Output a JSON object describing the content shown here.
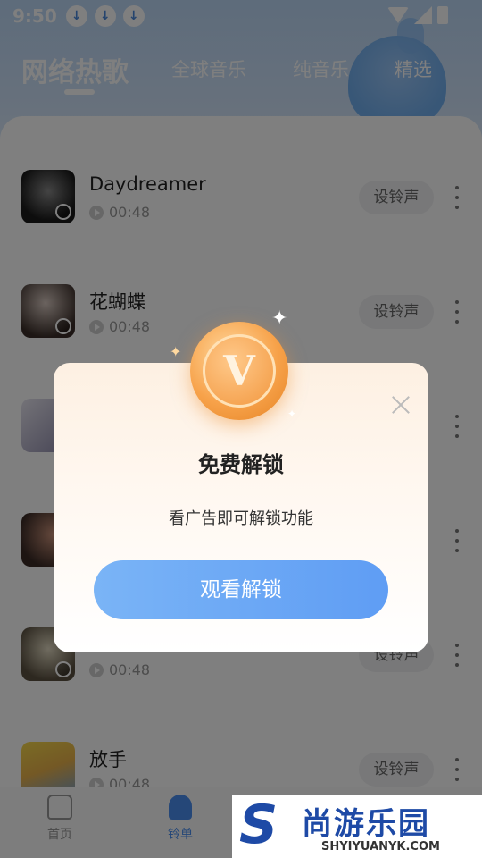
{
  "status_bar": {
    "time": "9:50",
    "download_icons": [
      "download-icon",
      "download-icon",
      "download-icon"
    ]
  },
  "tabs": [
    {
      "label": "网络热歌",
      "active": true
    },
    {
      "label": "全球音乐",
      "active": false
    },
    {
      "label": "纯音乐",
      "active": false
    },
    {
      "label": "精选",
      "active": false
    }
  ],
  "songs": [
    {
      "title": "Daydreamer",
      "duration": "00:48",
      "button": "设铃声",
      "cover_color": "#2a2a2a"
    },
    {
      "title": "花蝴蝶",
      "duration": "00:48",
      "button": "设铃声",
      "cover_color": "#6b5a52"
    },
    {
      "title": "",
      "duration": "",
      "button": "",
      "cover_color": "#8a86a8"
    },
    {
      "title": "",
      "duration": "",
      "button": "",
      "cover_color": "#5c4740"
    },
    {
      "title": "",
      "duration": "00:48",
      "button": "设铃声",
      "cover_color": "#7a7058"
    },
    {
      "title": "放手",
      "duration": "00:48",
      "button": "设铃声",
      "cover_color": "#e9c74a"
    }
  ],
  "bottom_nav": [
    {
      "label": "首页",
      "icon": "home-icon",
      "active": false
    },
    {
      "label": "铃单",
      "icon": "bell-icon",
      "active": true
    }
  ],
  "modal": {
    "coin_letter": "V",
    "title": "免费解锁",
    "description": "看广告即可解锁功能",
    "button": "观看解锁"
  },
  "watermark": {
    "logo_letter": "S",
    "name": "尚游乐园",
    "domain": "SHYIYUANYK.COM"
  },
  "colors": {
    "accent": "#5f9df4",
    "coin": "#f7a24a"
  }
}
